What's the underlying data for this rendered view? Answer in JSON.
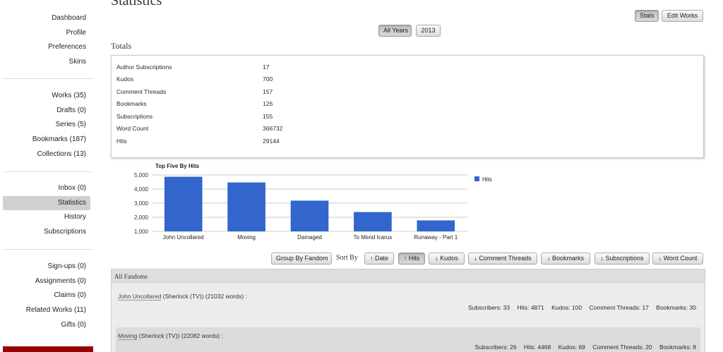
{
  "sidebar": {
    "group1": [
      "Dashboard",
      "Profile",
      "Preferences",
      "Skins"
    ],
    "group2": [
      "Works (35)",
      "Drafts (0)",
      "Series (5)",
      "Bookmarks (187)",
      "Collections (13)"
    ],
    "group3": [
      "Inbox (0)",
      "Statistics",
      "History",
      "Subscriptions"
    ],
    "group4": [
      "Sign-ups (0)",
      "Assignments (0)",
      "Claims (0)",
      "Related Works (11)",
      "Gifts (0)"
    ],
    "active": "Statistics"
  },
  "page": {
    "title": "Statistics"
  },
  "top_buttons": {
    "stats": "Stats",
    "edit_works": "Edit Works"
  },
  "year_filter": {
    "all_years": "All Years",
    "year_2013": "2013",
    "selected": "All Years"
  },
  "totals": {
    "heading": "Totals",
    "rows": [
      {
        "label": "Author Subscriptions",
        "value": "17"
      },
      {
        "label": "Kudos",
        "value": "700"
      },
      {
        "label": "Comment Threads",
        "value": "157"
      },
      {
        "label": "Bookmarks",
        "value": "126"
      },
      {
        "label": "Subscriptions",
        "value": "155"
      },
      {
        "label": "Word Count",
        "value": "366732"
      },
      {
        "label": "Hits",
        "value": "29144"
      }
    ]
  },
  "chart_data": {
    "type": "bar",
    "title": "Top Five By Hits",
    "categories": [
      "John Uncollared",
      "Moving",
      "Damaged",
      "To Mend Icarus",
      "Runaway - Part 1"
    ],
    "series": [
      {
        "name": "Hits",
        "values": [
          4871,
          4468,
          3180,
          2370,
          1780
        ],
        "color": "#3366cc"
      }
    ],
    "ylim": [
      1000,
      5000
    ],
    "yticks": [
      "1,000",
      "2,000",
      "3,000",
      "4,000",
      "5,000"
    ],
    "ytick_values": [
      1000,
      2000,
      3000,
      4000,
      5000
    ],
    "legend": "right",
    "grid": true
  },
  "sort_bar": {
    "group_by": "Group By Fandom",
    "label": "Sort By",
    "buttons": [
      "↑ Date",
      "↑ Hits",
      "↓ Kudos",
      "↓ Comment Threads",
      "↓ Bookmarks",
      "↓ Subscriptions",
      "↓ Word Count"
    ],
    "active": "↑ Hits"
  },
  "fandoms": {
    "header": "All Fandoms",
    "works": [
      {
        "title": "John Uncollared",
        "fandom_info": " (Sherlock (TV)) (21032 words) :",
        "stats": [
          "Subscribers: 33",
          "Hits: 4871",
          "Kudos: 100",
          "Comment Threads: 17",
          "Bookmarks: 30"
        ]
      },
      {
        "title": "Moving",
        "fandom_info": " (Sherlock (TV)) (22082 words) :",
        "stats": [
          "Subscribers: 26",
          "Hits: 4468",
          "Kudos: 69",
          "Comment Threads: 20",
          "Bookmarks: 8"
        ]
      }
    ]
  }
}
